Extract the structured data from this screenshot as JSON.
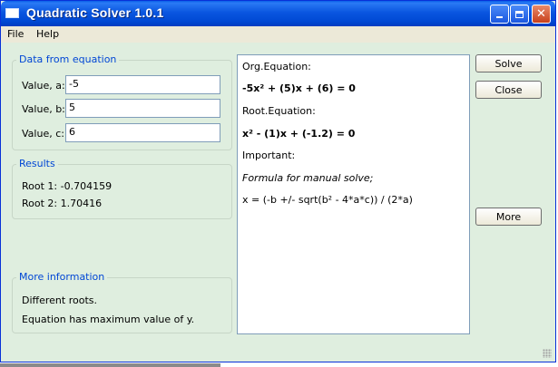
{
  "window": {
    "title": "Quadratic Solver 1.0.1",
    "minimize_icon": "minimize-icon",
    "maximize_icon": "maximize-icon",
    "close_icon": "close-icon"
  },
  "menu": {
    "file": "File",
    "help": "Help"
  },
  "data_group": {
    "title": "Data from equation",
    "label_a": "Value, a:",
    "label_b": "Value, b:",
    "label_c": "Value, c:",
    "value_a": "-5",
    "value_b": "5",
    "value_c": "6"
  },
  "results_group": {
    "title": "Results",
    "root1": "Root 1: -0.704159",
    "root2": "Root 2: 1.70416"
  },
  "info_group": {
    "title": "More information",
    "line1": "Different roots.",
    "line2": "Equation has maximum value of y."
  },
  "output": {
    "org_label": "Org.Equation:",
    "org_equation": "-5x² + (5)x + (6) = 0",
    "root_label": "Root.Equation:",
    "root_equation": "x² - (1)x + (-1.2) = 0",
    "important_label": "Important:",
    "formula_label": "Formula for manual solve;",
    "formula": "x = (-b +/- sqrt(b² - 4*a*c)) / (2*a)"
  },
  "buttons": {
    "solve": "Solve",
    "close": "Close",
    "more": "More"
  },
  "colors": {
    "titlebar": "#0a56e0",
    "background": "#dfeedf",
    "group_title": "#0046d5"
  }
}
